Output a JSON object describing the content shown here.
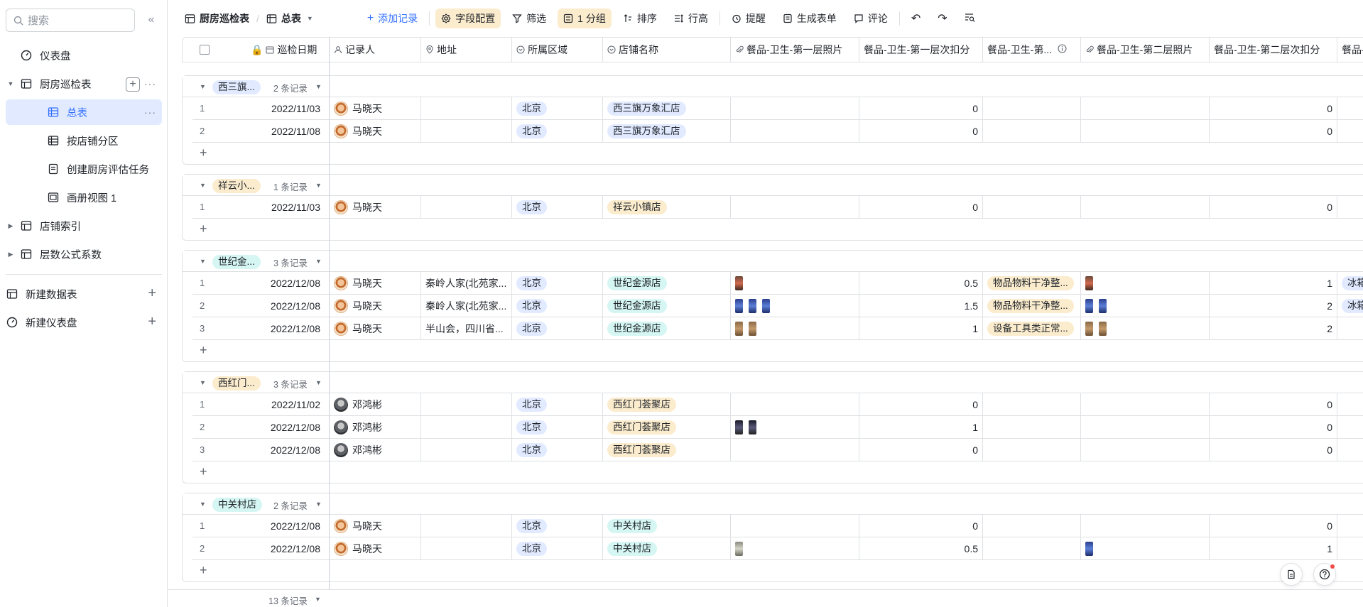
{
  "sidebar": {
    "search_placeholder": "搜索",
    "items": [
      {
        "label": "仪表盘"
      },
      {
        "label": "厨房巡检表"
      },
      {
        "label": "总表"
      },
      {
        "label": "按店铺分区"
      },
      {
        "label": "创建厨房评估任务"
      },
      {
        "label": "画册视图 1"
      },
      {
        "label": "店铺索引"
      },
      {
        "label": "层数公式系数"
      }
    ],
    "new_table": "新建数据表",
    "new_dashboard": "新建仪表盘"
  },
  "toolbar": {
    "table_name": "厨房巡检表",
    "view_name": "总表",
    "add_record": "添加记录",
    "field_config": "字段配置",
    "filter": "筛选",
    "group": "1 分组",
    "sort": "排序",
    "row_height": "行高",
    "reminder": "提醒",
    "gen_form": "生成表单",
    "comment": "评论"
  },
  "columns": [
    "巡检日期",
    "记录人",
    "地址",
    "所属区域",
    "店铺名称",
    "餐品-卫生-第一层照片",
    "餐品-卫生-第一层次扣分",
    "餐品-卫生-第...",
    "餐品-卫生-第二层照片",
    "餐品-卫生-第二层次扣分",
    "餐品-"
  ],
  "groups": [
    {
      "tag": "西三旗...",
      "color": "blue",
      "count": "2 条记录",
      "rows": [
        {
          "n": "1",
          "date": "2022/11/03",
          "person": "马晓天",
          "av": "a",
          "addr": "",
          "region": "北京",
          "shop": "西三旗万象汇店",
          "shopColor": "blue",
          "p1": [],
          "s1": "0",
          "r1": "",
          "p2": [],
          "s2": "0",
          "extra": ""
        },
        {
          "n": "2",
          "date": "2022/11/08",
          "person": "马晓天",
          "av": "a",
          "addr": "",
          "region": "北京",
          "shop": "西三旗万象汇店",
          "shopColor": "blue",
          "p1": [],
          "s1": "0",
          "r1": "",
          "p2": [],
          "s2": "0",
          "extra": ""
        }
      ]
    },
    {
      "tag": "祥云小...",
      "color": "orange",
      "count": "1 条记录",
      "rows": [
        {
          "n": "1",
          "date": "2022/11/03",
          "person": "马晓天",
          "av": "a",
          "addr": "",
          "region": "北京",
          "shop": "祥云小镇店",
          "shopColor": "orange",
          "p1": [],
          "s1": "0",
          "r1": "",
          "p2": [],
          "s2": "0",
          "extra": ""
        }
      ]
    },
    {
      "tag": "世纪金...",
      "color": "cyan",
      "count": "3 条记录",
      "rows": [
        {
          "n": "1",
          "date": "2022/12/08",
          "person": "马晓天",
          "av": "a",
          "addr": "秦岭人家(北苑家...",
          "region": "北京",
          "shop": "世纪金源店",
          "shopColor": "cyan",
          "p1": [
            "red"
          ],
          "s1": "0.5",
          "r1": "物品物料干净整...",
          "p2": [
            "red"
          ],
          "s2": "1",
          "extra": "冰箱"
        },
        {
          "n": "2",
          "date": "2022/12/08",
          "person": "马晓天",
          "av": "a",
          "addr": "秦岭人家(北苑家...",
          "region": "北京",
          "shop": "世纪金源店",
          "shopColor": "cyan",
          "p1": [
            "blue",
            "blue",
            "blue"
          ],
          "s1": "1.5",
          "r1": "物品物料干净整...",
          "p2": [
            "blue",
            "blue"
          ],
          "s2": "2",
          "extra": "冰箱"
        },
        {
          "n": "3",
          "date": "2022/12/08",
          "person": "马晓天",
          "av": "a",
          "addr": "半山会，四川省...",
          "region": "北京",
          "shop": "世纪金源店",
          "shopColor": "cyan",
          "p1": [
            "brown",
            "brown"
          ],
          "s1": "1",
          "r1": "设备工具类正常...",
          "p2": [
            "brown",
            "brown"
          ],
          "s2": "2",
          "extra": ""
        }
      ]
    },
    {
      "tag": "西红门...",
      "color": "orange",
      "count": "3 条记录",
      "rows": [
        {
          "n": "1",
          "date": "2022/11/02",
          "person": "邓鸿彬",
          "av": "b",
          "addr": "",
          "region": "北京",
          "shop": "西红门荟聚店",
          "shopColor": "orange",
          "p1": [],
          "s1": "0",
          "r1": "",
          "p2": [],
          "s2": "0",
          "extra": ""
        },
        {
          "n": "2",
          "date": "2022/12/08",
          "person": "邓鸿彬",
          "av": "b",
          "addr": "",
          "region": "北京",
          "shop": "西红门荟聚店",
          "shopColor": "orange",
          "p1": [
            "dark",
            "dark"
          ],
          "s1": "1",
          "r1": "",
          "p2": [],
          "s2": "0",
          "extra": ""
        },
        {
          "n": "3",
          "date": "2022/12/08",
          "person": "邓鸿彬",
          "av": "b",
          "addr": "",
          "region": "北京",
          "shop": "西红门荟聚店",
          "shopColor": "orange",
          "p1": [],
          "s1": "0",
          "r1": "",
          "p2": [],
          "s2": "0",
          "extra": ""
        }
      ]
    },
    {
      "tag": "中关村店",
      "color": "cyan",
      "count": "2 条记录",
      "rows": [
        {
          "n": "1",
          "date": "2022/12/08",
          "person": "马晓天",
          "av": "a",
          "addr": "",
          "region": "北京",
          "shop": "中关村店",
          "shopColor": "cyan",
          "p1": [],
          "s1": "0",
          "r1": "",
          "p2": [],
          "s2": "0",
          "extra": ""
        },
        {
          "n": "2",
          "date": "2022/12/08",
          "person": "马晓天",
          "av": "a",
          "addr": "",
          "region": "北京",
          "shop": "中关村店",
          "shopColor": "cyan",
          "p1": [
            "gray"
          ],
          "s1": "0.5",
          "r1": "",
          "p2": [
            "blue"
          ],
          "s2": "1",
          "extra": ""
        }
      ]
    }
  ],
  "footer": {
    "total": "13 条记录"
  }
}
